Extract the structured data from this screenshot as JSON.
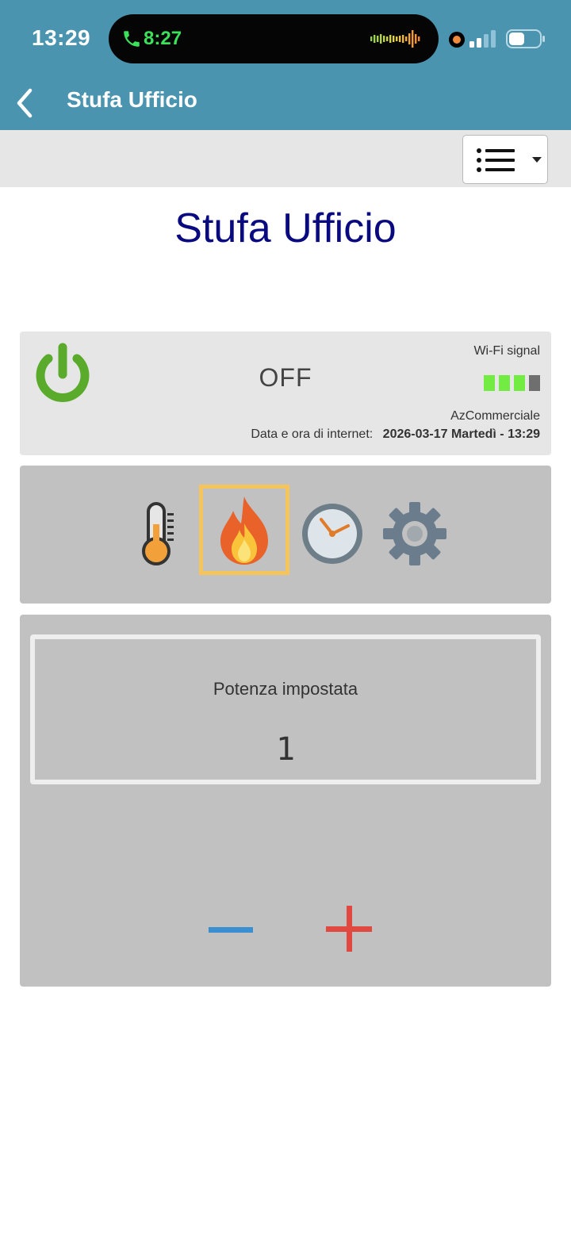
{
  "status_bar": {
    "time": "13:29",
    "call_time": "8:27",
    "call_color": "#3ce05a"
  },
  "header": {
    "title": "Stufa Ufficio",
    "background": "#4a94b0"
  },
  "toolbar": {
    "menu_icon": "list-icon"
  },
  "page": {
    "title": "Stufa Ufficio",
    "title_color": "#0a0a80"
  },
  "status_panel": {
    "state": "OFF",
    "wifi_label": "Wi-Fi signal",
    "wifi_level": 3,
    "wifi_max": 4,
    "network_name": "AzCommerciale",
    "datetime_label": "Data e ora di internet:",
    "datetime_value": "2026-03-17 Martedì - 13:29",
    "power_icon_color": "#5aaa2c"
  },
  "modes": [
    {
      "id": "temperature",
      "icon": "thermometer-icon",
      "active": false
    },
    {
      "id": "flame",
      "icon": "flame-icon",
      "active": true
    },
    {
      "id": "timer",
      "icon": "clock-icon",
      "active": false
    },
    {
      "id": "settings",
      "icon": "gear-icon",
      "active": false
    }
  ],
  "power_panel": {
    "label": "Potenza impostata",
    "value": "1",
    "minus_color": "#3a8fd0",
    "plus_color": "#e04840"
  }
}
